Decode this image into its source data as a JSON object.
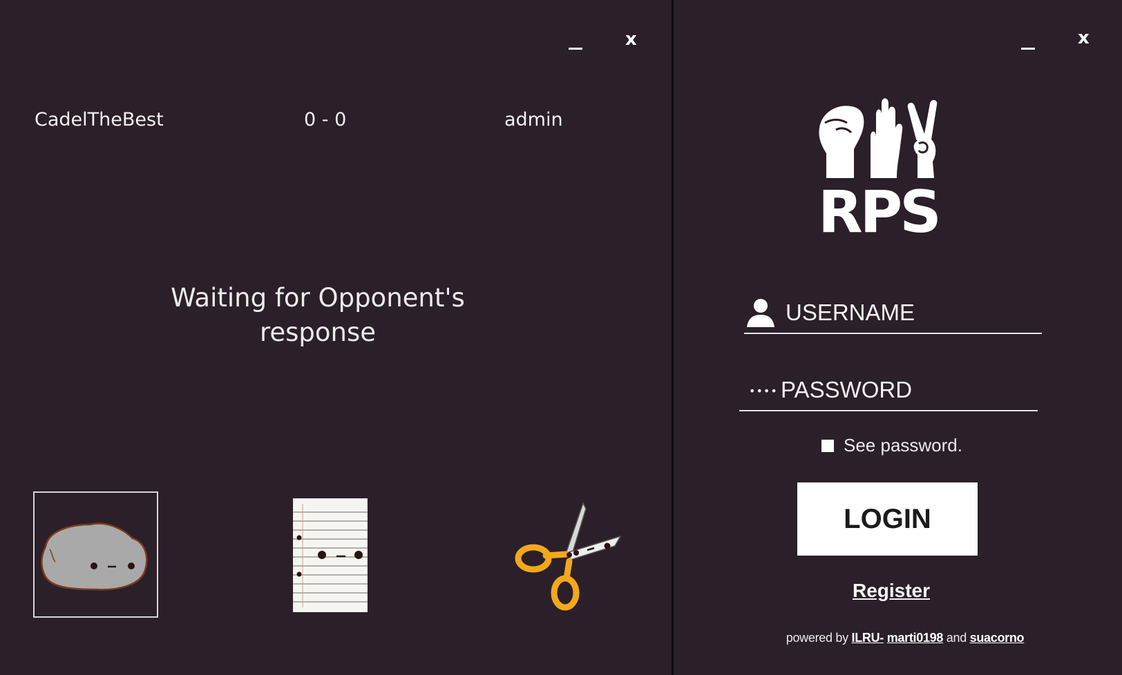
{
  "game": {
    "window": {
      "minimize_label": "_",
      "close_label": "x"
    },
    "players": {
      "left": "CadelTheBest",
      "right": "admin"
    },
    "score": "0 - 0",
    "status_line1": "Waiting for Opponent's",
    "status_line2": "response",
    "choices": [
      "rock",
      "paper",
      "scissors"
    ],
    "selected_choice": "rock"
  },
  "login": {
    "window": {
      "minimize_label": "_",
      "close_label": "x"
    },
    "logo_text": "RPS",
    "username_label": "USERNAME",
    "password_label": "PASSWORD",
    "password_icon": "••••",
    "see_password_label": "See password.",
    "login_button": "LOGIN",
    "register_link": "Register",
    "footer": {
      "prefix": "powered by",
      "author1": "ILRU-",
      "author2": "marti0198",
      "conjunction": "and",
      "author3": "suacorno"
    }
  },
  "colors": {
    "background": "#2b1f29",
    "text": "#f2f2f2",
    "button_bg": "#ffffff",
    "scissors_handle": "#f2a81d",
    "rock": "#a9a9a9"
  }
}
